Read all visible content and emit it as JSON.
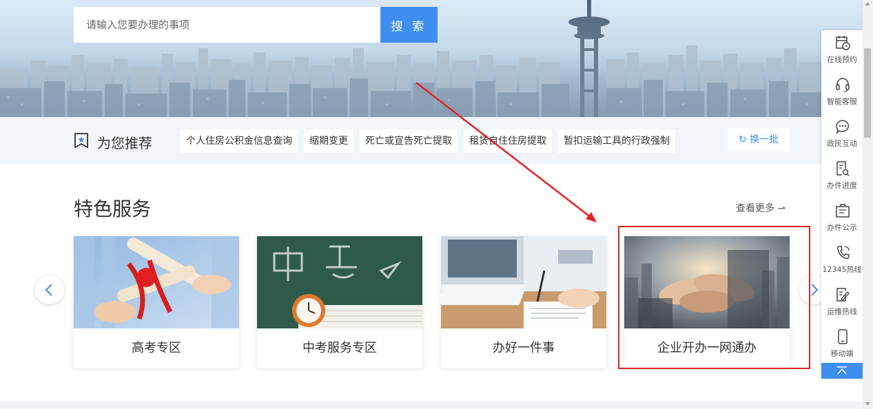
{
  "search": {
    "placeholder": "请输入您要办理的事项",
    "button_label": "搜 索"
  },
  "recommend": {
    "title": "为您推荐",
    "tags": [
      "个人住房公积金信息查询",
      "缩期变更",
      "死亡或宣告死亡提取",
      "租赁自住住房提取",
      "暂扣运输工具的行政强制"
    ],
    "refresh_label": "换一批"
  },
  "featured": {
    "title": "特色服务",
    "more_label": "查看更多",
    "cards": [
      {
        "label": "高考专区",
        "image": "diploma-scrolls-photo"
      },
      {
        "label": "中考服务专区",
        "image": "chalkboard-clock-photo"
      },
      {
        "label": "办好一件事",
        "image": "signing-document-photo"
      },
      {
        "label": "企业开办一网通办",
        "image": "joined-hands-photo"
      }
    ]
  },
  "toolbar": {
    "items": [
      {
        "label": "在线预约",
        "icon": "calendar-clock-icon"
      },
      {
        "label": "智能客服",
        "icon": "headset-icon"
      },
      {
        "label": "政民互动",
        "icon": "chat-bubble-icon"
      },
      {
        "label": "办件进度",
        "icon": "document-search-icon"
      },
      {
        "label": "办件公示",
        "icon": "notice-board-icon"
      },
      {
        "label": "12345热线",
        "icon": "phone-icon"
      },
      {
        "label": "运维热线",
        "icon": "edit-document-icon"
      },
      {
        "label": "移动端",
        "icon": "mobile-phone-icon"
      }
    ]
  },
  "colors": {
    "accent": "#3e8ef0",
    "highlight": "#e32222",
    "band": "#f1f5f9"
  }
}
